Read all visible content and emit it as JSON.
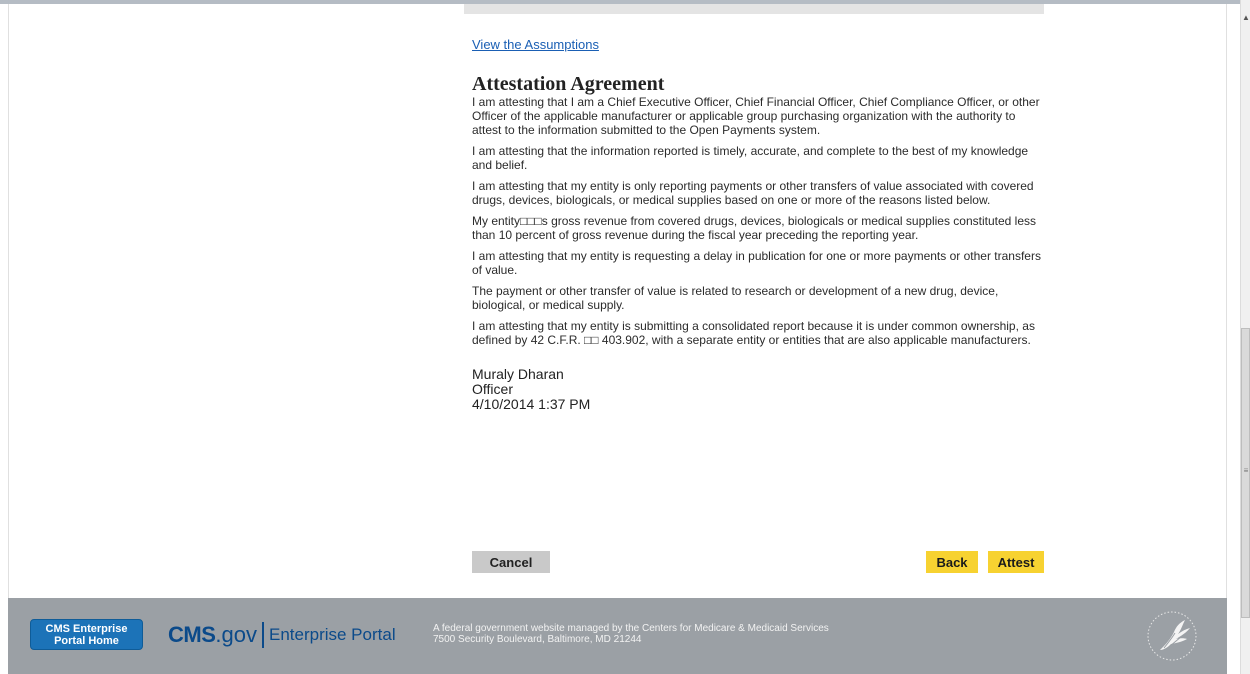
{
  "links": {
    "view_assumptions": "View the Assumptions"
  },
  "agreement": {
    "title": "Attestation Agreement",
    "paragraphs": [
      "I am attesting that I am a Chief Executive Officer, Chief Financial Officer, Chief Compliance Officer, or other Officer of the applicable manufacturer or applicable group purchasing organization with the authority to attest to the information submitted to the Open Payments system.",
      "I am attesting that the information reported is timely, accurate, and complete to the best of my knowledge and belief.",
      "I am attesting that my entity is only reporting payments or other transfers of value associated with covered drugs, devices, biologicals, or medical supplies based on one or more of the reasons listed below.",
      "My entity□□□s gross revenue from covered drugs, devices, biologicals or medical supplies constituted less than 10 percent of gross revenue during the fiscal year preceding the reporting year.",
      "I am attesting that my entity is requesting a delay in publication for one or more payments or other transfers of value.",
      "The payment or other transfer of value is related to research or development of a new drug, device, biological, or medical supply.",
      "I am attesting that my entity is submitting a consolidated report because it is under common ownership, as defined by 42 C.F.R. □□ 403.902, with a separate entity or entities that are also applicable manufacturers."
    ]
  },
  "signature": {
    "name": "Muraly Dharan",
    "role": "Officer",
    "timestamp": "4/10/2014 1:37 PM"
  },
  "buttons": {
    "cancel": "Cancel",
    "back": "Back",
    "attest": "Attest"
  },
  "footer": {
    "portal_home_line1": "CMS Enterprise",
    "portal_home_line2": "Portal Home",
    "logo_cms": "CMS",
    "logo_gov": ".gov",
    "logo_portal": "Enterprise Portal",
    "text_line1": "A federal government website managed by the Centers for Medicare & Medicaid Services",
    "text_line2": "7500 Security Boulevard, Baltimore, MD 21244"
  },
  "colors": {
    "link": "#1a5fb4",
    "button_primary": "#f7d231",
    "button_secondary": "#c9c9c9",
    "footer_bg": "#9ba0a5",
    "portal_button": "#1c73b8",
    "logo": "#0b4a8a"
  },
  "icons": {
    "hhs_logo": "hhs-eagle-icon",
    "scroll_up": "scroll-up-arrow-icon",
    "scroll_grip": "scroll-grip-icon"
  }
}
